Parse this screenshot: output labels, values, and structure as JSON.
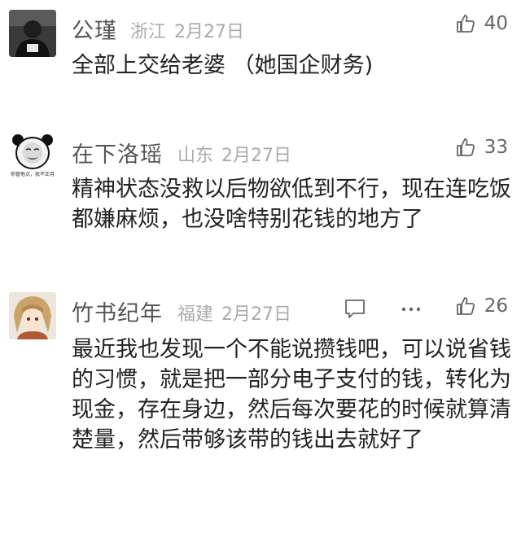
{
  "comments": [
    {
      "username": "公瑾",
      "location": "浙江",
      "date": "2月27日",
      "likes": "40",
      "text": "全部上交给老婆 （她国企财务)",
      "avatar_icon": "user-avatar-dark-icon",
      "avatar_text": ""
    },
    {
      "username": "在下洛瑶",
      "location": "山东",
      "date": "2月27日",
      "likes": "33",
      "text": "精神状态没救以后物欲低到不行，现在连吃饭都嫌麻烦，也没啥特别花钱的地方了",
      "avatar_icon": "panda-meme-icon",
      "avatar_text": "你管他点，我不正月"
    },
    {
      "username": "竹书纪年",
      "location": "福建",
      "date": "2月27日",
      "likes": "26",
      "text": "最近我也发现一个不能说攒钱吧，可以说省钱的习惯，就是把一部分电子支付的钱，转化为现金，存在身边，然后每次要花的时候就算清楚量，然后带够该带的钱出去就好了",
      "avatar_icon": "anime-avatar-icon",
      "avatar_text": ""
    }
  ],
  "icons": {
    "like": "thumbs-up-icon",
    "reply": "comment-bubble-icon",
    "more": "more-dots-icon"
  },
  "colors": {
    "text": "#222222",
    "username": "#555555",
    "meta": "#aaaaaa",
    "icon": "#666666"
  }
}
